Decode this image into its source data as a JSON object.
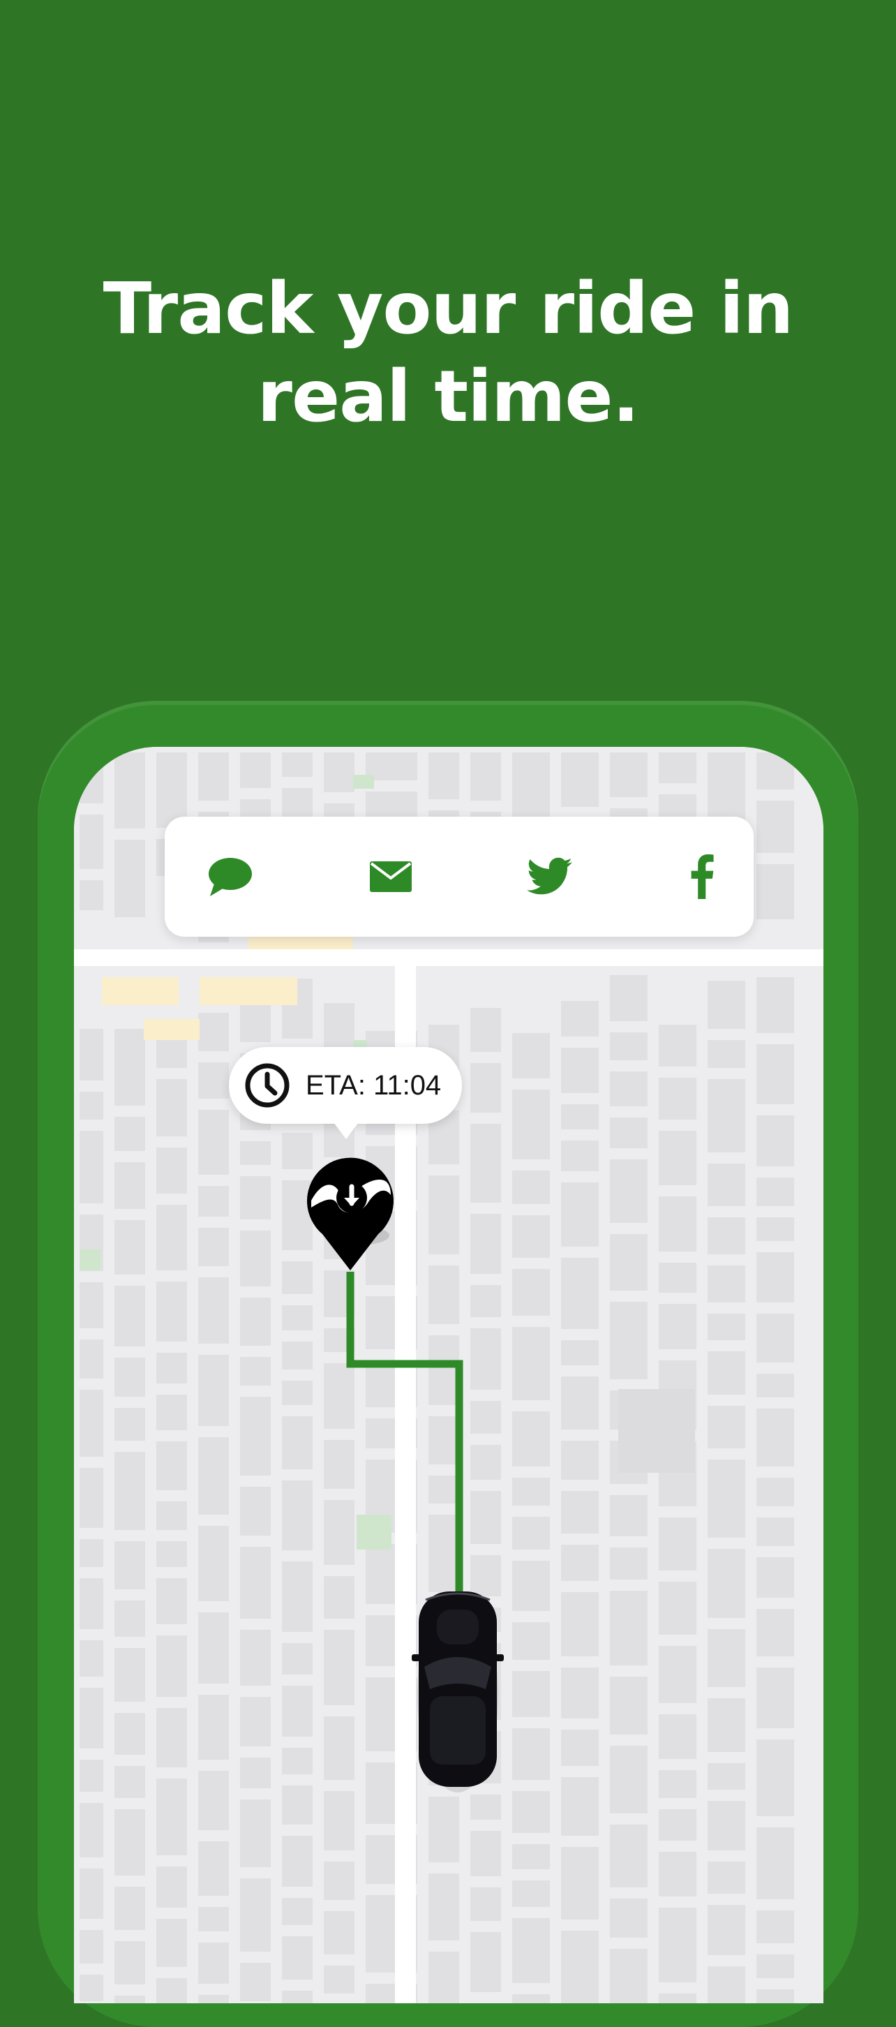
{
  "headline": {
    "line1": "Track your ride in",
    "line2": "real time."
  },
  "colors": {
    "background": "#2e7526",
    "phone_frame": "#338a2b",
    "accent": "#2e8a27",
    "route": "#2e8a27",
    "pin": "#000000"
  },
  "share_bar": {
    "items": [
      {
        "name": "Message",
        "icon": "chat-bubble-icon"
      },
      {
        "name": "Email",
        "icon": "envelope-icon"
      },
      {
        "name": "Twitter",
        "icon": "twitter-bird-icon"
      },
      {
        "name": "Facebook",
        "icon": "facebook-f-icon"
      }
    ]
  },
  "eta": {
    "icon": "clock-icon",
    "text": "ETA: 11:04"
  },
  "destination_pin": {
    "icon": "download-arrow-icon"
  },
  "vehicle": {
    "icon": "car-icon"
  }
}
